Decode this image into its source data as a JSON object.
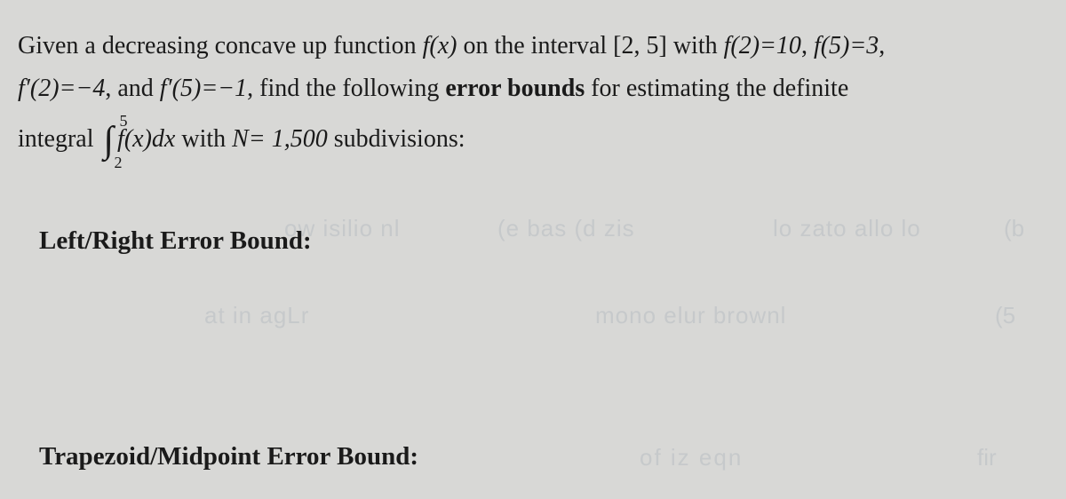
{
  "problem": {
    "line1_part1": "Given a decreasing concave up function ",
    "fx": "f(x)",
    "line1_part2": " on the interval [2, 5] with ",
    "f2": "f(2)=10",
    "comma1": ", ",
    "f5": "f(5)=3",
    "comma2": ",",
    "fprime2": "f′(2)=−4",
    "line2_part1": ", and ",
    "fprime5": "f′(5)=−1",
    "line2_part2": ", find the following ",
    "error_bounds": "error bounds",
    "line2_part3": " for estimating the definite",
    "line3_part1": "integral ",
    "integral_upper": "5",
    "integral_lower": "2",
    "integrand": "f(x)dx",
    "line3_part2": " with ",
    "n_value": "N= 1,500",
    "line3_part3": " subdivisions:"
  },
  "sections": {
    "left_right": "Left/Right Error Bound:",
    "trapezoid": "Trapezoid/Midpoint Error Bound:"
  },
  "ghost": {
    "g1": "ow isilio nl",
    "g2": "(e bas (d zis",
    "g3": "lo zato allo lo",
    "g4": "at in agLr",
    "g5": "mono elur brownl",
    "g6": "of iz eqn",
    "g7": "fir",
    "g8": "(5",
    "g9": "(b"
  }
}
